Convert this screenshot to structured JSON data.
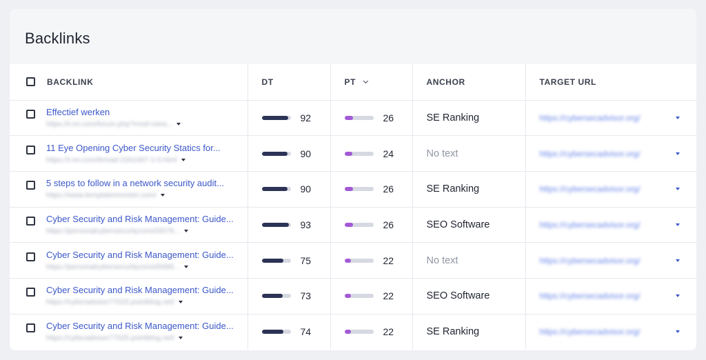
{
  "card": {
    "title": "Backlinks"
  },
  "table": {
    "columns": {
      "backlink": "BACKLINK",
      "dt": "DT",
      "pt": "PT",
      "anchor": "ANCHOR",
      "target": "TARGET URL"
    },
    "rows": [
      {
        "title": "Effectief werken",
        "url": "https://t.mi.com/forum.php?mod=view...",
        "dt": 92,
        "pt": 26,
        "dt_fill": 0.92,
        "pt_fill": 0.3,
        "anchor": "SE Ranking",
        "anchor_muted": false,
        "target": "https://cybersecadvisor.org/"
      },
      {
        "title": "11 Eye Opening Cyber Security Statics for...",
        "url": "https://t.mi.com/thread-2261067-1-0.html",
        "dt": 90,
        "pt": 24,
        "dt_fill": 0.9,
        "pt_fill": 0.28,
        "anchor": "No text",
        "anchor_muted": true,
        "target": "https://cybersecadvisor.org/"
      },
      {
        "title": "5 steps to follow in a network security audit...",
        "url": "https://www.templatemonster.com/",
        "dt": 90,
        "pt": 26,
        "dt_fill": 0.9,
        "pt_fill": 0.3,
        "anchor": "SE Ranking",
        "anchor_muted": false,
        "target": "https://cybersecadvisor.org/"
      },
      {
        "title": "Cyber Security and Risk Management: Guide...",
        "url": "https://personalcybersecuritycons03579...",
        "dt": 93,
        "pt": 26,
        "dt_fill": 0.93,
        "pt_fill": 0.3,
        "anchor": "SEO Software",
        "anchor_muted": false,
        "target": "https://cybersecadvisor.org/"
      },
      {
        "title": "Cyber Security and Risk Management: Guide...",
        "url": "https://personalcybersecuritycons05689...",
        "dt": 75,
        "pt": 22,
        "dt_fill": 0.75,
        "pt_fill": 0.22,
        "anchor": "No text",
        "anchor_muted": true,
        "target": "https://cybersecadvisor.org/"
      },
      {
        "title": "Cyber Security and Risk Management: Guide...",
        "url": "https://cyberadvisor77025.pointblog.net/",
        "dt": 73,
        "pt": 22,
        "dt_fill": 0.73,
        "pt_fill": 0.22,
        "anchor": "SEO Software",
        "anchor_muted": false,
        "target": "https://cybersecadvisor.org/"
      },
      {
        "title": "Cyber Security and Risk Management: Guide...",
        "url": "https://cyberadvisor77025.pointblog.net/",
        "dt": 74,
        "pt": 22,
        "dt_fill": 0.74,
        "pt_fill": 0.22,
        "anchor": "SE Ranking",
        "anchor_muted": false,
        "target": "https://cybersecadvisor.org/"
      }
    ]
  }
}
